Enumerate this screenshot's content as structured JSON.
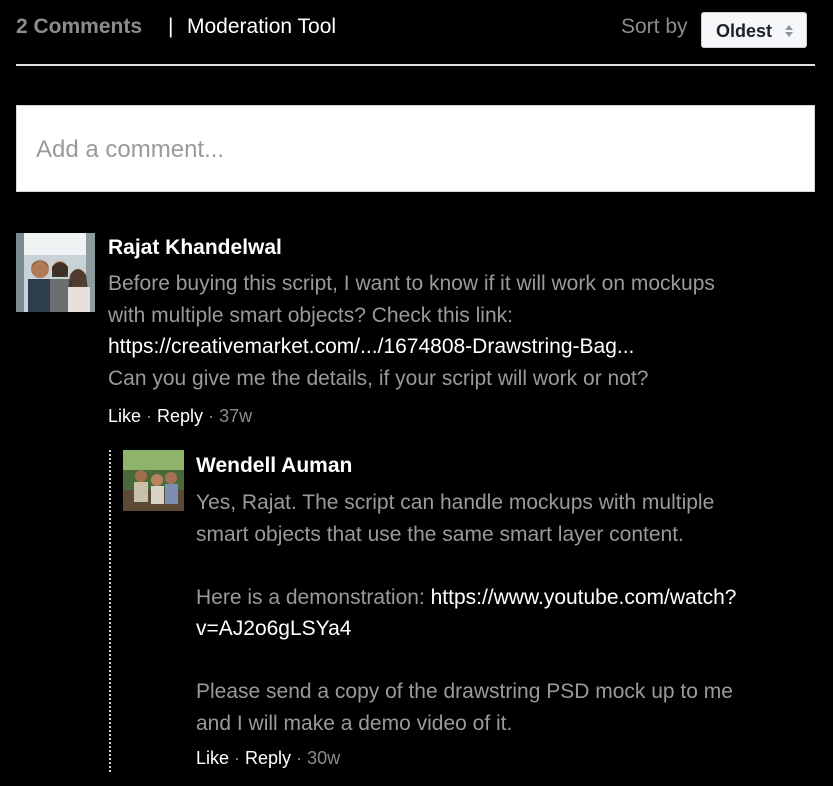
{
  "header": {
    "comment_count": "2 Comments",
    "separator": "|",
    "moderation_tool": "Moderation Tool",
    "sort_label": "Sort by",
    "sort_value": "Oldest"
  },
  "composer": {
    "placeholder": "Add a comment..."
  },
  "comments": [
    {
      "author": "Rajat Khandelwal",
      "text_line_1": "Before buying this script, I want to know if it will work on mockups",
      "text_line_2": "with multiple smart objects? Check this link:",
      "link": "https://creativemarket.com/.../1674808-Drawstring-Bag...",
      "text_line_4": "Can you give me the details, if your script will work or not?",
      "like": "Like",
      "reply": "Reply",
      "time": "37w"
    },
    {
      "author": "Wendell Auman",
      "text_line_1": "Yes, Rajat. The script can handle mockups with multiple",
      "text_line_2": "smart objects that use the same smart layer content.",
      "demo_prefix": "Here is a demonstration: ",
      "demo_link_part1": "https://www.youtube.com/watch?",
      "demo_link_part2": "v=AJ2o6gLSYa4",
      "text_line_5": "Please send a copy of the drawstring PSD mock up to me",
      "text_line_6": "and I will make a demo video of it.",
      "like": "Like",
      "reply": "Reply",
      "time": "30w"
    }
  ],
  "colors": {
    "background": "#000000",
    "muted_text": "#9a9a9a",
    "link_text": "#ffffff",
    "divider": "#dddfe2"
  }
}
